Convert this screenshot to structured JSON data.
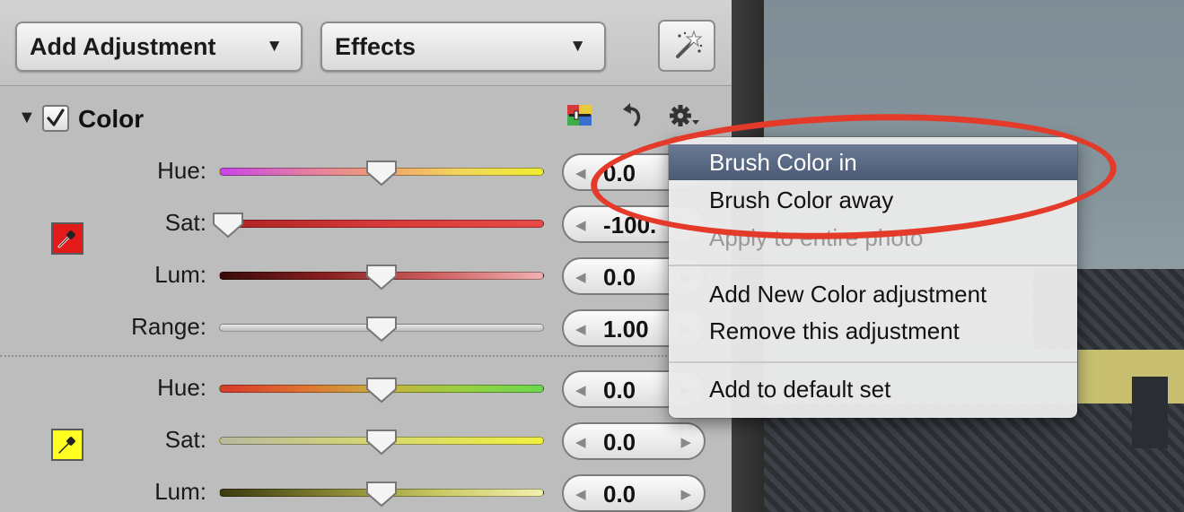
{
  "toolbar": {
    "add_adjustment": "Add Adjustment",
    "effects": "Effects",
    "dropdown_arrow": "▼"
  },
  "section": {
    "title": "Color",
    "checked": true
  },
  "group1": {
    "swatch_color": "#e41a1a",
    "rows": [
      {
        "label": "Hue:",
        "value": "0.0",
        "level": 0.5
      },
      {
        "label": "Sat:",
        "value": "-100.",
        "level": 0.0
      },
      {
        "label": "Lum:",
        "value": "0.0",
        "level": 0.5
      },
      {
        "label": "Range:",
        "value": "1.00",
        "level": 0.5
      }
    ]
  },
  "group2": {
    "swatch_color": "#ffff22",
    "rows": [
      {
        "label": "Hue:",
        "value": "0.0",
        "level": 0.5
      },
      {
        "label": "Sat:",
        "value": "0.0",
        "level": 0.5
      },
      {
        "label": "Lum:",
        "value": "0.0",
        "level": 0.5
      }
    ]
  },
  "menu": {
    "items": [
      {
        "label": "Brush Color in",
        "highlighted": true,
        "enabled": true
      },
      {
        "label": "Brush Color away",
        "highlighted": false,
        "enabled": true
      },
      {
        "label": "Apply to entire photo",
        "highlighted": false,
        "enabled": false
      },
      {
        "label": "Add New Color adjustment",
        "highlighted": false,
        "enabled": true
      },
      {
        "label": "Remove this adjustment",
        "highlighted": false,
        "enabled": true
      },
      {
        "label": "Add to default set",
        "highlighted": false,
        "enabled": true
      }
    ]
  },
  "icons": {
    "magic_wand": "magic-wand-icon",
    "color_picker": "color-adjust-icon",
    "reset": "reset-arrow-icon",
    "gear": "gear-icon",
    "eyedropper": "eyedropper-icon"
  },
  "colors": {
    "annotation_ring": "#e33a2a",
    "menu_highlight": "#5a6a84"
  }
}
